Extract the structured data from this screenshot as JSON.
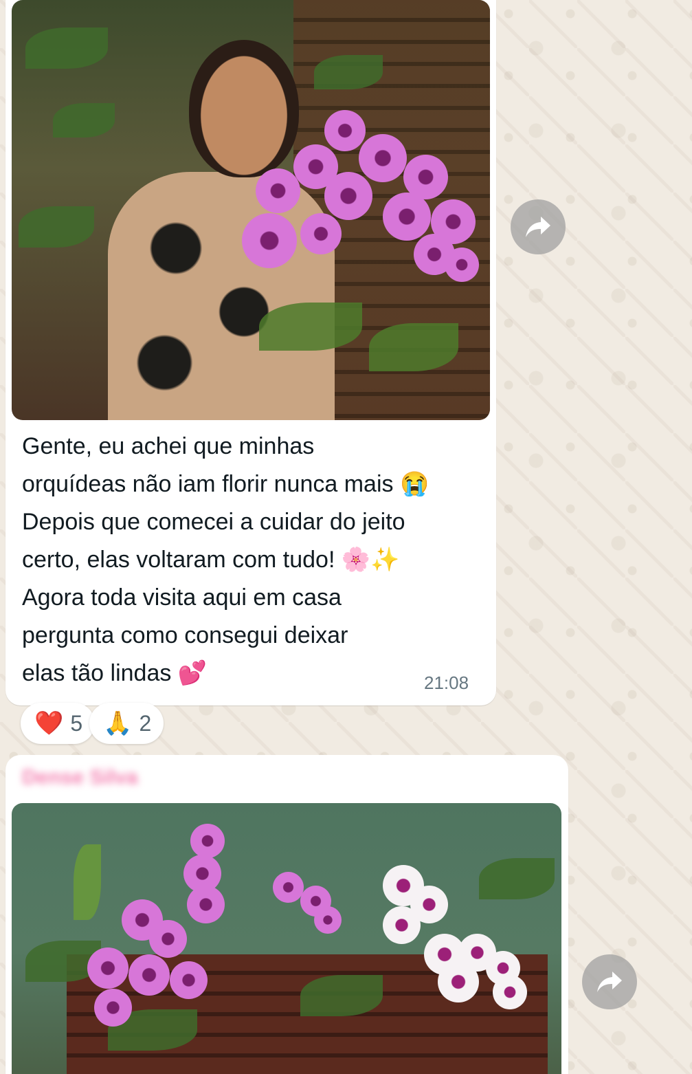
{
  "messages": [
    {
      "image": "photo-woman-holding-pink-orchids",
      "text_lines": [
        "Gente, eu achei que minhas",
        "orquídeas não iam florir nunca mais 😭",
        "Depois que comecei a cuidar do jeito",
        "certo, elas voltaram com tudo! 🌸✨",
        "Agora toda visita aqui em casa",
        "pergunta como consegui deixar",
        "elas tão lindas 💕"
      ],
      "time": "21:08",
      "reactions": [
        {
          "emoji": "❤️",
          "count": "5"
        },
        {
          "emoji": "🙏",
          "count": "2"
        }
      ]
    },
    {
      "sender": "Dense Silva",
      "sender_color": "#f47fb0",
      "image": "photo-orchids-on-wooden-shelf"
    }
  ],
  "icons": {
    "forward": "forward-arrow-icon"
  },
  "colors": {
    "wallpaper": "#f1ebe2",
    "bubble": "#ffffff",
    "text": "#111b21",
    "timestamp": "#667781"
  }
}
